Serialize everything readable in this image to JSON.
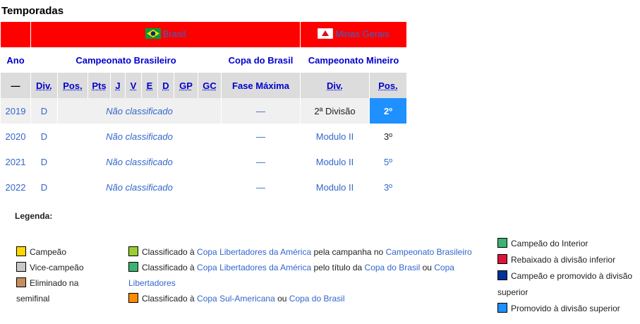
{
  "section_title": "Temporadas",
  "header": {
    "country": "Brasil",
    "state": "Minas Gerais"
  },
  "subheader": {
    "ano": "Ano",
    "brasileiro": "Campeonato Brasileiro",
    "copa": "Copa do Brasil",
    "mineiro": "Campeonato Mineiro"
  },
  "columns": {
    "dash": "—",
    "div": "Div.",
    "pos": "Pos.",
    "pts": "Pts",
    "j": "J",
    "v": "V",
    "e": "E",
    "d": "D",
    "gp": "GP",
    "gc": "GC",
    "fase": "Fase Máxima",
    "mdiv": "Div.",
    "mpos": "Pos."
  },
  "rows": [
    {
      "year": "2019",
      "div": "D",
      "status": "Não classificado",
      "copa": "—",
      "mdiv": "2ª Divisão",
      "mpos": "2º"
    },
    {
      "year": "2020",
      "div": "D",
      "status": "Não classificado",
      "copa": "—",
      "mdiv": "Modulo II",
      "mpos": "3º"
    },
    {
      "year": "2021",
      "div": "D",
      "status": "Não classificado",
      "copa": "—",
      "mdiv": "Modulo II",
      "mpos": "5º"
    },
    {
      "year": "2022",
      "div": "D",
      "status": "Não classificado",
      "copa": "—",
      "mdiv": "Modulo II",
      "mpos": "3º"
    }
  ],
  "legend": {
    "title": "Legenda:",
    "campeao": "Campeão",
    "vice": "Vice-campeão",
    "semi_1": "Eliminado na",
    "semi_2": "semifinal",
    "lib1_a": "Classificado à ",
    "lib1_link": "Copa Libertadores da América",
    "lib1_b": " pela campanha no ",
    "lib1_link2": "Campeonato Brasileiro",
    "lib2_a": "Classificado à ",
    "lib2_link": "Copa Libertadores da América",
    "lib2_b": " pelo título da ",
    "lib2_link2": "Copa do Brasil",
    "lib2_c": " ou ",
    "lib2_link3a": "Copa",
    "lib2_link3b": "Libertadores",
    "sul_a": "Classificado à ",
    "sul_link": "Copa Sul-Americana",
    "sul_b": " ou ",
    "sul_link2": "Copa do Brasil",
    "interior": "Campeão do Interior",
    "rebaixado": "Rebaixado à divisão inferior",
    "promovido_1": "Campeão e promovido à divisão",
    "promovido_2": "superior",
    "promovido_sup": "Promovido à divisão superior"
  },
  "colors": {
    "red": "#ff0000",
    "gold": "#ffd700",
    "silver": "#c8c8c8",
    "bronze": "#c58e5d",
    "lime": "#9acd32",
    "green": "#3cb371",
    "orange": "#ff8c00",
    "interior": "#3cb371",
    "rebaixado": "#dc143c",
    "campeao_promovido": "#003399",
    "promovido": "#1e90ff"
  }
}
